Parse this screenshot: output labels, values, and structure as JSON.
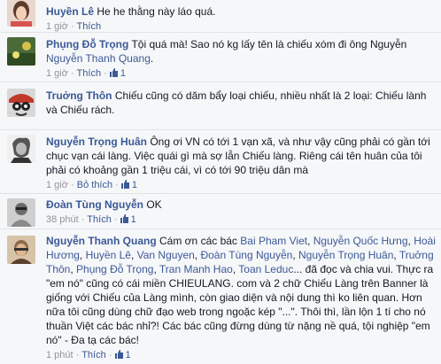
{
  "comments": [
    {
      "author": "Huyền Lê",
      "text": "He he thằng này láo quá."
    },
    {
      "author": "Phụng Đỗ Trọng",
      "text": "Tội quá mà! Sao nó kg lấy tên là chiếu xóm đi ông Nguyễn ",
      "tag": "Nguyễn Thanh Quang",
      "text_after": "."
    },
    {
      "author": "Truởng Thôn",
      "text": "Chiếu cũng có dăm bẩy loại chiếu, nhiều nhất là 2 loại: Chiếu lành và Chiếu rách."
    },
    {
      "author": "Nguyễn Trọng Huân",
      "text": "Ông ơi VN có tới 1 vạn xã, và như vậy cũng phải có gần tới chục vạn cái làng. Việc quái gì mà sợ lẫn Chiếu làng. Riêng cái tên huân của tôi phải có khoảng gần 1 triệu cái, vì có tới 90 triệu dân mà",
      "time": "1 giờ",
      "action": "Bỏ thích",
      "likes": "1"
    },
    {
      "author": "Đoàn Tùng Nguyễn",
      "text": "OK",
      "time": "38 phút",
      "action": "Thích",
      "likes": "1"
    },
    {
      "author": "Nguyễn Thanh Quang",
      "intro": "Cám ơn các bác ",
      "tags": [
        "Bai Pham Viet",
        "Nguyễn Quốc Hưng",
        "Hoài Hương",
        "Huyền Lê",
        "Van Nguyen",
        "Đoàn Tùng Nguyễn",
        "Nguyễn Trọng Huân",
        "Truởng Thôn",
        "Phụng Đỗ Trọng",
        "Tran Manh Hao",
        "Toan Leduc"
      ],
      "text": "... đã đọc và chia vui. Thực ra \"em nó\" cũng có cái miền CHIEULANG. com và 2 chữ Chiếu Làng trên Banner là giống với Chiếu của Làng mình, còn giao diện và nội dung thì ko liên quan. Hơn nữa tôi cũng dùng chữ đạo web trong ngoặc kép \"...\". Thôi thì, lần lộn 1 tí cho nó thuần Việt các bác nhỉ?! Các bác cũng đừng dùng từ nặng nề quá, tội nghiệp \"em nó\" - Đa tạ các bác!",
      "time": "1 phút",
      "action": "Thích",
      "likes": "1"
    }
  ],
  "meta_partial": {
    "c1_time": "1 giờ",
    "c1_action": "Thích",
    "c2_time": "1 giờ",
    "c2_action": "Thích",
    "c2_likes": "1"
  },
  "ui": {
    "separator": "·",
    "link_color": "#3b5998",
    "meta_color": "#90949c"
  }
}
